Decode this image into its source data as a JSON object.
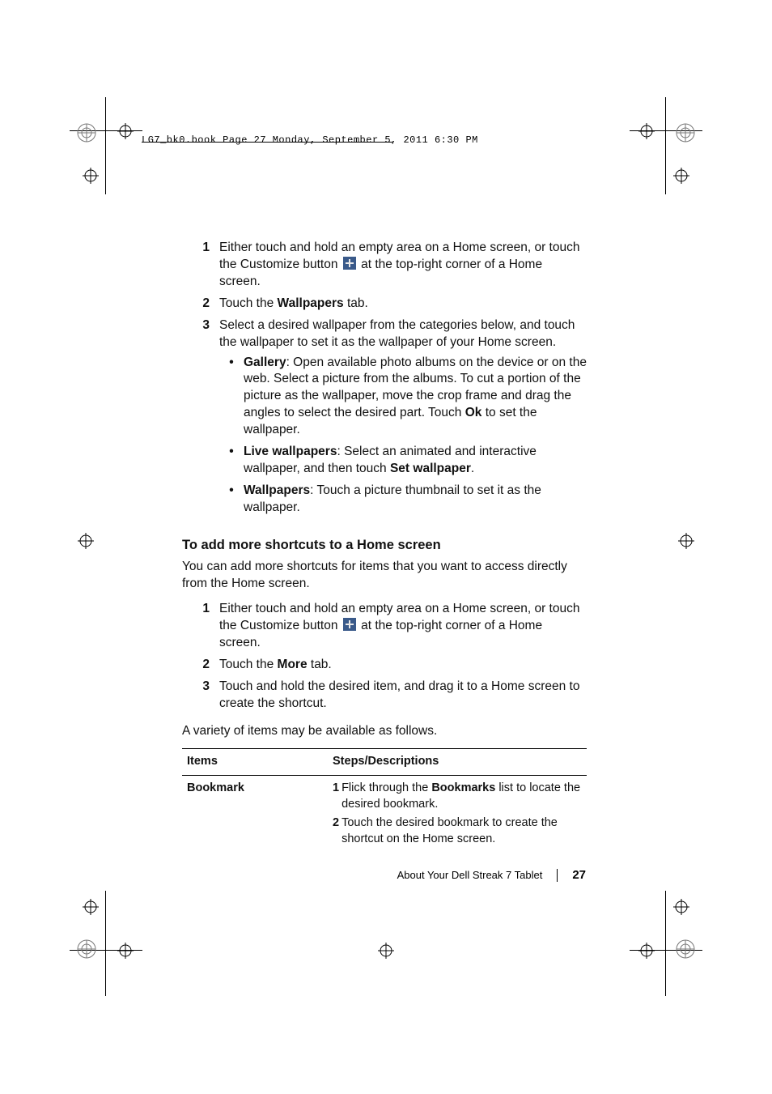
{
  "header": "LG7_bk0.book  Page 27  Monday, September 5, 2011  6:30 PM",
  "steps1": {
    "n1": "1",
    "s1a": "Either touch and hold an empty area on a Home screen, or touch the Customize button ",
    "s1b": " at the top-right corner of a Home screen.",
    "n2": "2",
    "s2a": "Touch the ",
    "s2b": "Wallpapers",
    "s2c": " tab.",
    "n3": "3",
    "s3": "Select a desired wallpaper from the categories below, and touch the wallpaper to set it as the wallpaper of your Home screen."
  },
  "bullets": {
    "b1t": "Gallery",
    "b1a": ": Open available photo albums on the device or on the web. Select a picture from the albums. To cut a portion of the picture as the wallpaper, move the crop frame and drag the angles to select the desired part. Touch ",
    "b1b": "Ok",
    "b1c": " to set the wallpaper.",
    "b2t": "Live wallpapers",
    "b2a": ": Select an animated and interactive wallpaper, and then touch ",
    "b2b": "Set wallpaper",
    "b2c": ".",
    "b3t": "Wallpapers",
    "b3a": ": Touch a picture thumbnail to set it as the wallpaper."
  },
  "section2": {
    "heading": "To add more shortcuts to a Home screen",
    "intro": "You can add more shortcuts for items that you want to access directly from the Home screen."
  },
  "steps2": {
    "n1": "1",
    "s1a": "Either touch and hold an empty area on a Home screen, or touch the Customize button ",
    "s1b": " at the top-right corner of a Home screen.",
    "n2": "2",
    "s2a": "Touch the ",
    "s2b": "More",
    "s2c": " tab.",
    "n3": "3",
    "s3": "Touch and hold the desired item, and drag it to a Home screen to create the shortcut."
  },
  "tableIntro": "A variety of items may be available as follows.",
  "table": {
    "h1": "Items",
    "h2": "Steps/Descriptions",
    "r1name": "Bookmark",
    "r1s1n": "1",
    "r1s1a": "Flick through the ",
    "r1s1b": "Bookmarks",
    "r1s1c": " list to locate the desired bookmark.",
    "r1s2n": "2",
    "r1s2": "Touch the desired bookmark to create the shortcut on the Home screen."
  },
  "footer": {
    "title": "About Your Dell Streak 7 Tablet",
    "page": "27"
  }
}
